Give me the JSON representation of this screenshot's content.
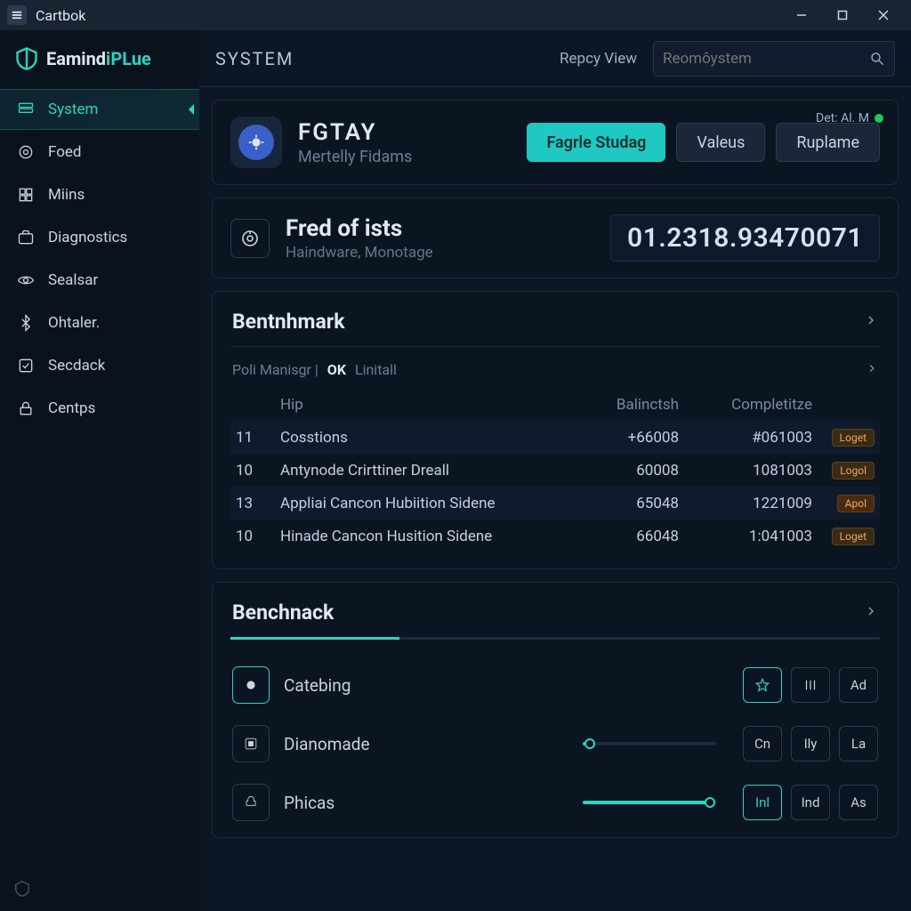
{
  "titlebar": {
    "app_name": "Cartbok"
  },
  "brand": {
    "part_a": "Eamind",
    "part_b": "iPLue"
  },
  "sidebar": {
    "items": [
      {
        "label": "System"
      },
      {
        "label": "Foed"
      },
      {
        "label": "Miins"
      },
      {
        "label": "Diagnostics"
      },
      {
        "label": "Sealsar"
      },
      {
        "label": "Ohtaler."
      },
      {
        "label": "Secdack"
      },
      {
        "label": "Centps"
      }
    ]
  },
  "header": {
    "breadcrumb": "SYSTEM",
    "view_link": "Repcy View",
    "search_placeholder": "Reomôystem"
  },
  "identity": {
    "title": "FGTAY",
    "subtitle": "Mertelly Fidams",
    "status_label": "Det: Al. M",
    "buttons": {
      "primary": "Fagrle Studag",
      "secondary1": "Valeus",
      "secondary2": "Ruplame"
    }
  },
  "metric": {
    "title": "Fred of ists",
    "subtitle": "Haindware, Monotage",
    "value": "01.2318.93470071"
  },
  "benchmark": {
    "title": "Bentnhmark",
    "crumb_left": "Poli Manisgr",
    "crumb_ok": "OK",
    "crumb_right": "Linitall",
    "columns": {
      "c1": "Hip",
      "c2": "Balinctsh",
      "c3": "Completitze"
    },
    "rows": [
      {
        "n": "11",
        "name": "Cosstions",
        "b": "+66008",
        "c": "#061003",
        "badge": "Loget"
      },
      {
        "n": "10",
        "name": "Antynode Crirttiner Dreall",
        "b": "60008",
        "c": "1081003",
        "badge": "Logol"
      },
      {
        "n": "13",
        "name": "Appliai Cancon Hubiition Sidene",
        "b": "65048",
        "c": "1221009",
        "badge": "Apol"
      },
      {
        "n": "10",
        "name": "Hinade Cancon Husition Sidene",
        "b": "66048",
        "c": "1:041003",
        "badge": "Loget"
      }
    ]
  },
  "benchnack": {
    "title": "Benchnack",
    "tools": [
      {
        "label": "Catebing",
        "slider": null,
        "btns": [
          "star",
          "bars",
          "Ad"
        ],
        "active_btn": 0
      },
      {
        "label": "Dianomade",
        "slider": 5,
        "btns": [
          "Cn",
          "Ily",
          "La"
        ],
        "active_btn": -1
      },
      {
        "label": "Phicas",
        "slider": 95,
        "btns": [
          "Inl",
          "Ind",
          "As"
        ],
        "active_btn": 0
      }
    ]
  }
}
